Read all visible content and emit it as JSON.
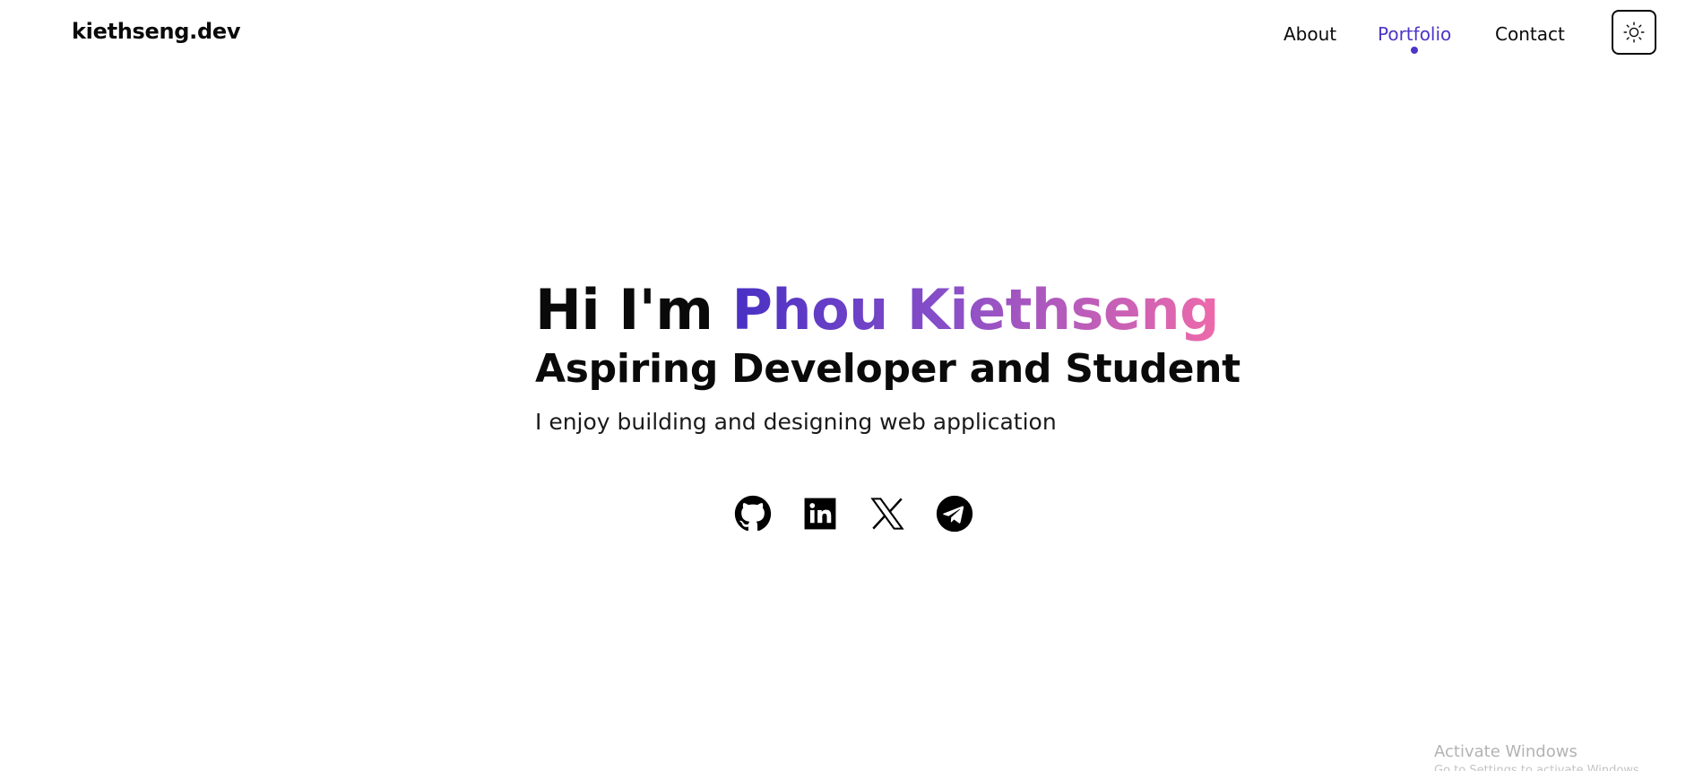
{
  "header": {
    "brand": "kiethseng.dev",
    "nav": [
      {
        "label": "About",
        "active": false
      },
      {
        "label": "Portfolio",
        "active": true
      },
      {
        "label": "Contact",
        "active": false
      }
    ],
    "theme_toggle_icon": "sun-icon"
  },
  "hero": {
    "greeting": "Hi I'm",
    "name": "Phou Kiethseng",
    "subtitle": "Aspiring Developer and Student",
    "description": "I enjoy building and designing web application"
  },
  "socials": [
    {
      "icon": "github-icon"
    },
    {
      "icon": "linkedin-icon"
    },
    {
      "icon": "x-icon"
    },
    {
      "icon": "telegram-icon"
    }
  ],
  "os_overlay": {
    "activate_title": "Activate Windows",
    "activate_sub": "Go to Settings to activate Windows."
  },
  "colors": {
    "accent": "#4c35c7",
    "gradient_start": "#4830c4",
    "gradient_end": "#ee6aaa",
    "text": "#0a0a0a"
  }
}
